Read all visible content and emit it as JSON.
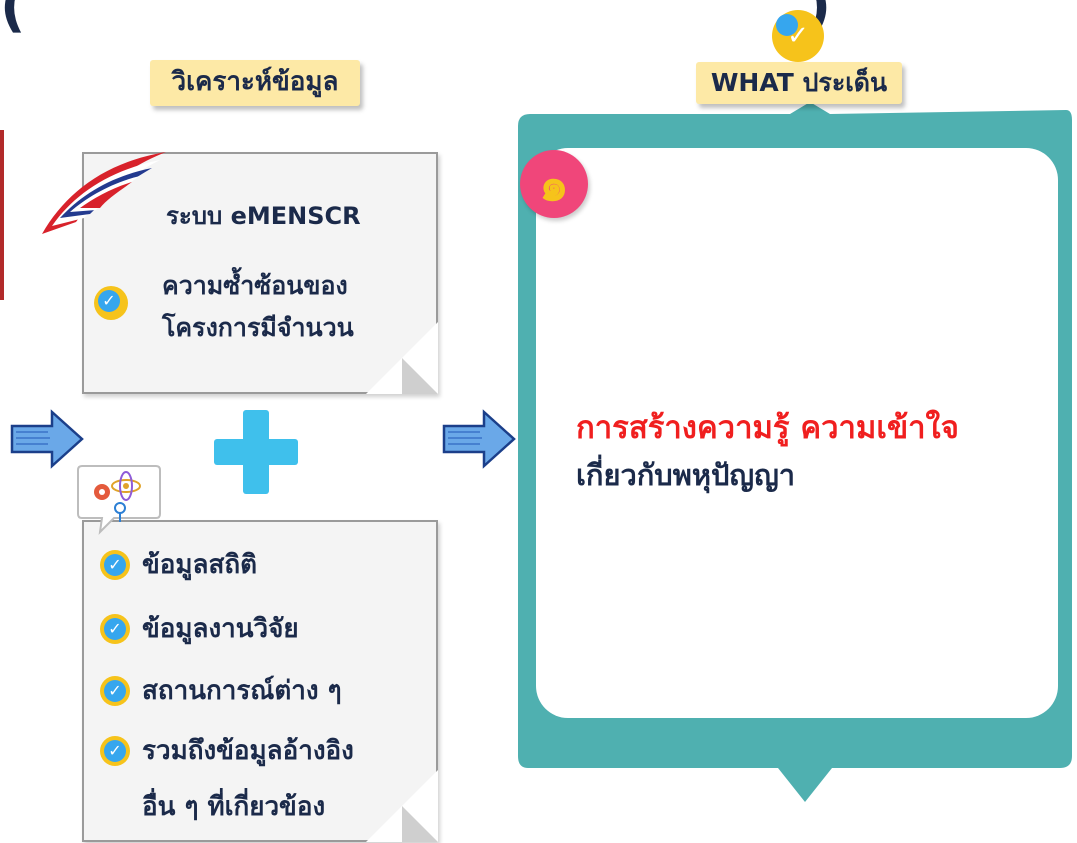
{
  "header": {
    "title_fragment": "(                                        )"
  },
  "left": {
    "tag_label": "วิเคราะห์ข้อมูล",
    "top_card": {
      "system_name": "ระบบ eMENSCR",
      "point_line1": "ความซ้ำซ้อนของ",
      "point_line2": "โครงการมีจำนวน"
    },
    "bottom_card": {
      "items": [
        "ข้อมูลสถิติ",
        "ข้อมูลงานวิจัย",
        "สถานการณ์ต่าง ๆ",
        "รวมถึงข้อมูลอ้างอิง"
      ],
      "item_continuation": "อื่น ๆ ที่เกี่ยวข้อง"
    }
  },
  "right": {
    "tag_label": "WHAT ประเด็น",
    "badge_number": "๑",
    "highlight_text": "การสร้างความรู้ ความเข้าใจ",
    "sub_text": "เกี่ยวกับพหุปัญญา"
  },
  "colors": {
    "teal_frame": "#4fb0b0",
    "highlight_red": "#f01f1f",
    "plus_blue": "#3fc0ec",
    "tag_yellow": "#fde9a6",
    "badge_pink": "#f0467a"
  }
}
